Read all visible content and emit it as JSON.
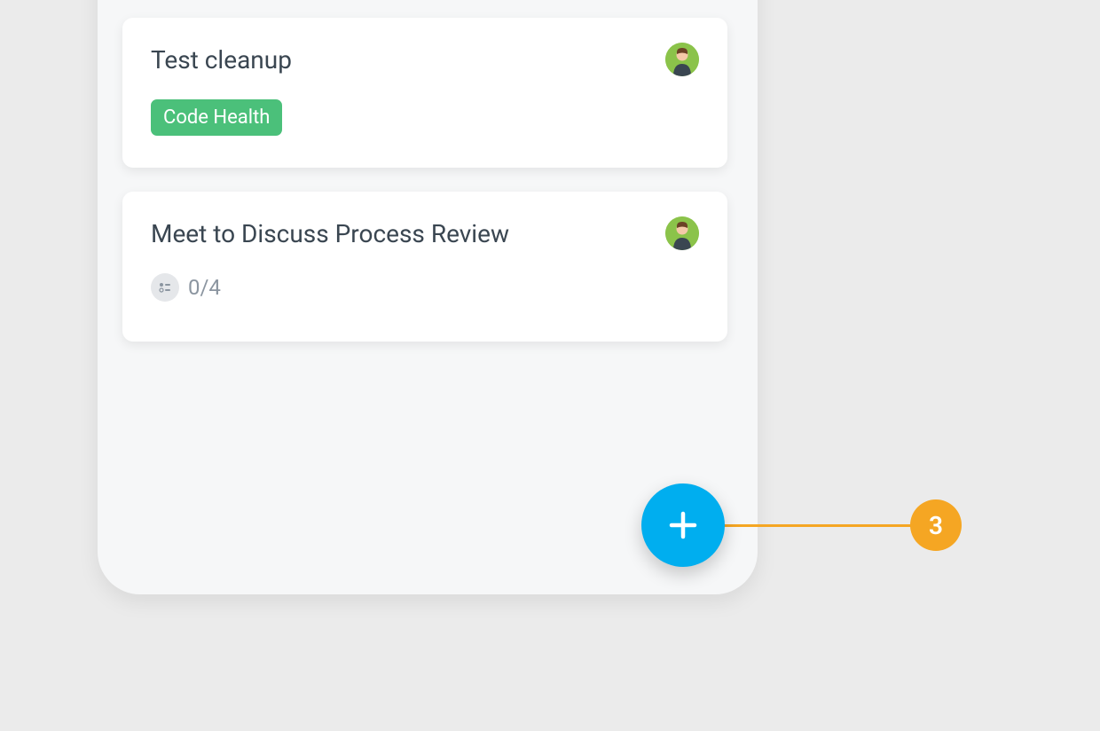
{
  "cards": [
    {
      "title": "Test cleanup",
      "tag": "Code Health"
    },
    {
      "title": "Meet to Discuss Process Review",
      "checklist": "0/4"
    }
  ],
  "callout": {
    "number": "3"
  }
}
